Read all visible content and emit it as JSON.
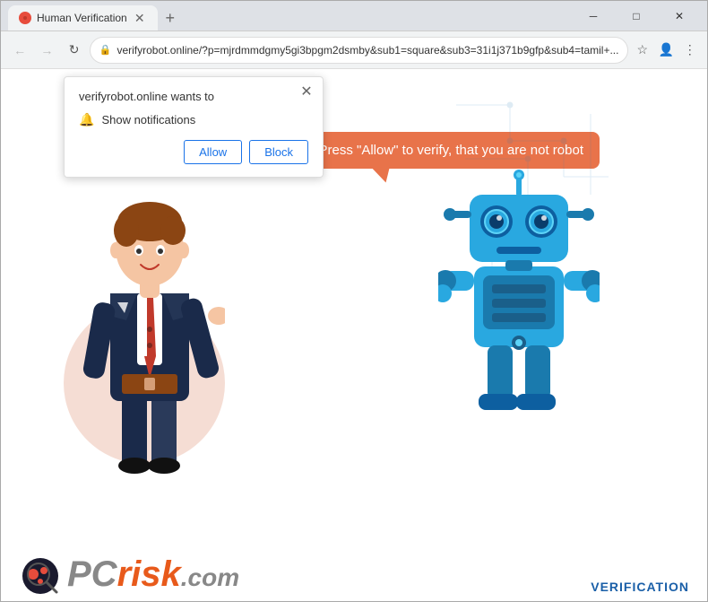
{
  "browser": {
    "tab": {
      "title": "Human Verification",
      "favicon": "●"
    },
    "new_tab_button": "+",
    "url": "verifyrobot.online/?p=mjrdmmdgmy5gi3bpgm2dsmby&sub1=square&sub3=31i1j371b9gfp&sub4=tamil+...",
    "url_lock": "🔒",
    "window_controls": {
      "minimize": "─",
      "maximize": "□",
      "close": "✕"
    },
    "nav": {
      "back": "←",
      "forward": "→",
      "refresh": "↻"
    }
  },
  "popup": {
    "title": "verifyrobot.online wants to",
    "notification_label": "Show notifications",
    "allow_button": "Allow",
    "block_button": "Block",
    "close": "✕"
  },
  "page": {
    "speech_bubble": "Press \"Allow\" to verify, that you are not robot"
  },
  "footer": {
    "logo_pc": "PC",
    "logo_risk": "risk",
    "logo_dotcom": ".com",
    "verification": "VERIFICATION"
  }
}
